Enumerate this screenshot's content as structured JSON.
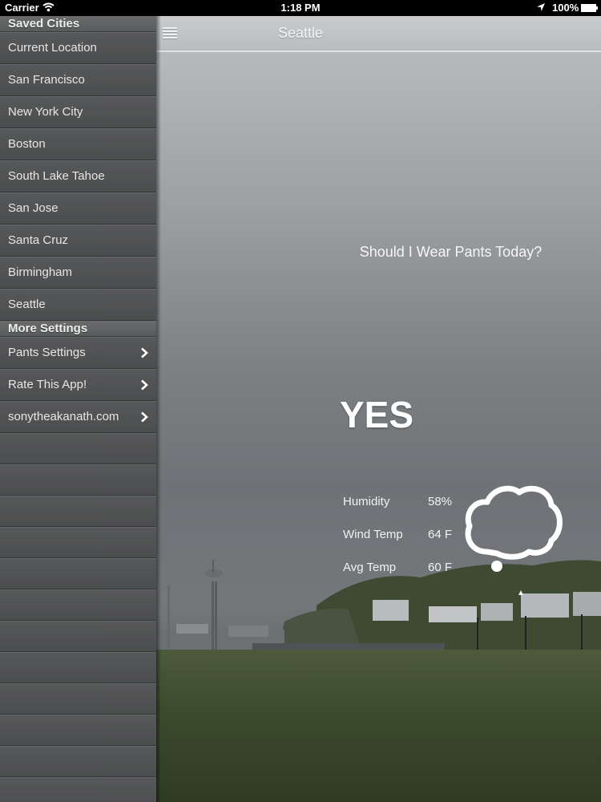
{
  "status_bar": {
    "carrier": "Carrier",
    "time": "1:18 PM",
    "battery": "100%"
  },
  "sidebar": {
    "saved_cities_header": "Saved Cities",
    "cities": [
      "Current Location",
      "San Francisco",
      "New York City",
      "Boston",
      "South Lake Tahoe",
      "San Jose",
      "Santa Cruz",
      "Birmingham",
      "Seattle"
    ],
    "more_settings_header": "More Settings",
    "settings": [
      "Pants Settings",
      "Rate This App!",
      "sonytheakanath.com"
    ]
  },
  "main": {
    "title": "Seattle",
    "question": "Should I Wear Pants Today?",
    "answer": "YES",
    "stats": [
      {
        "label": "Humidity",
        "value": "58%"
      },
      {
        "label": "Wind Temp",
        "value": "64 F"
      },
      {
        "label": "Avg Temp",
        "value": "60 F"
      }
    ],
    "weather_icon": "cloud-icon"
  },
  "colors": {
    "sidebar_bg": "#505152",
    "sidebar_text": "#e6e6e6",
    "header_text": "#eceded",
    "content_text": "#ffffff"
  }
}
